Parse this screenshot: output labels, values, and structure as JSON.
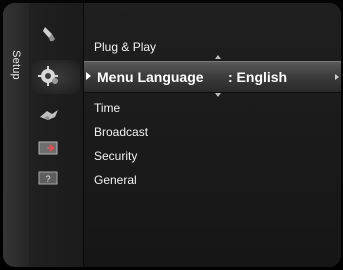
{
  "menu": {
    "title": "Setup",
    "items": [
      {
        "label": "Plug & Play"
      },
      {
        "label": "Menu Language",
        "value": ": English"
      },
      {
        "label": "Time"
      },
      {
        "label": "Broadcast"
      },
      {
        "label": "Security"
      },
      {
        "label": "General"
      }
    ]
  },
  "side_icons": [
    "picture-icon",
    "setup-gear-icon",
    "application-icon",
    "input-icon",
    "support-icon"
  ]
}
